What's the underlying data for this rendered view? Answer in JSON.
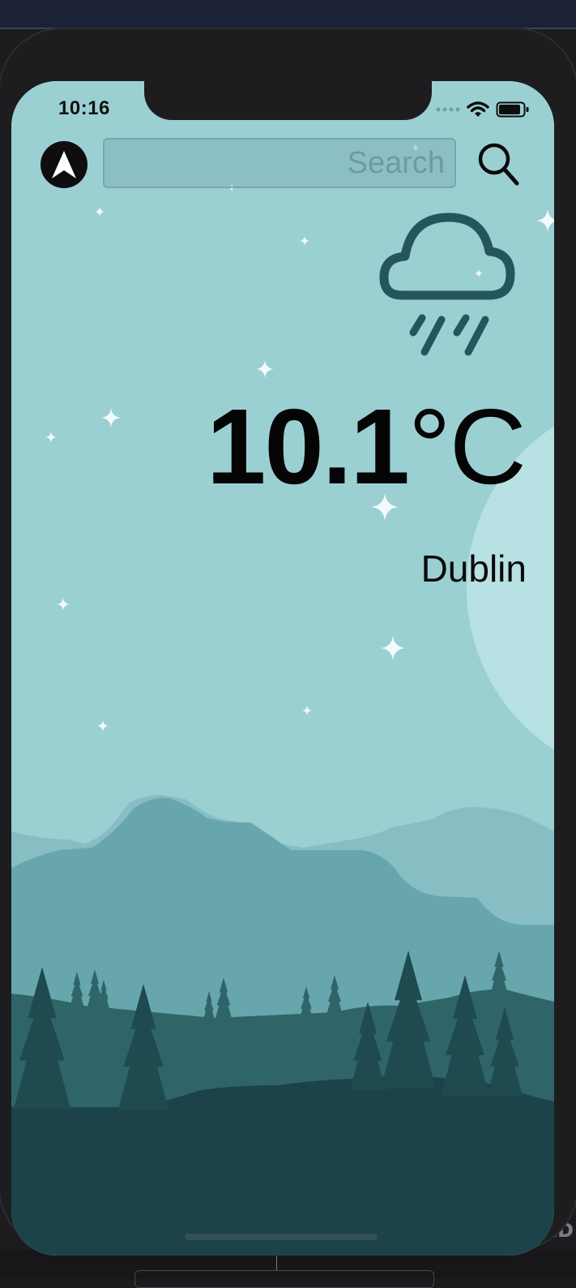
{
  "status_bar": {
    "time": "10:16"
  },
  "search": {
    "placeholder": "Search",
    "value": ""
  },
  "weather": {
    "condition_icon": "cloud-rain-icon",
    "temperature": "10.1",
    "unit": "°C",
    "city": "Dublin"
  },
  "background_text": {
    "corner": "LD"
  },
  "icons": {
    "location": "navigation-arrow-icon",
    "search": "magnifier-icon",
    "signal": "signal-dots-icon",
    "wifi": "wifi-icon",
    "battery": "battery-icon"
  },
  "colors": {
    "sky": "#9bd0d3",
    "moon": "#b8e1e4",
    "hill_far": "#87bec3",
    "hill_mid": "#67a6ad",
    "hill_near": "#2f6569",
    "ground": "#1d434a",
    "icon_stroke": "#24565c"
  }
}
